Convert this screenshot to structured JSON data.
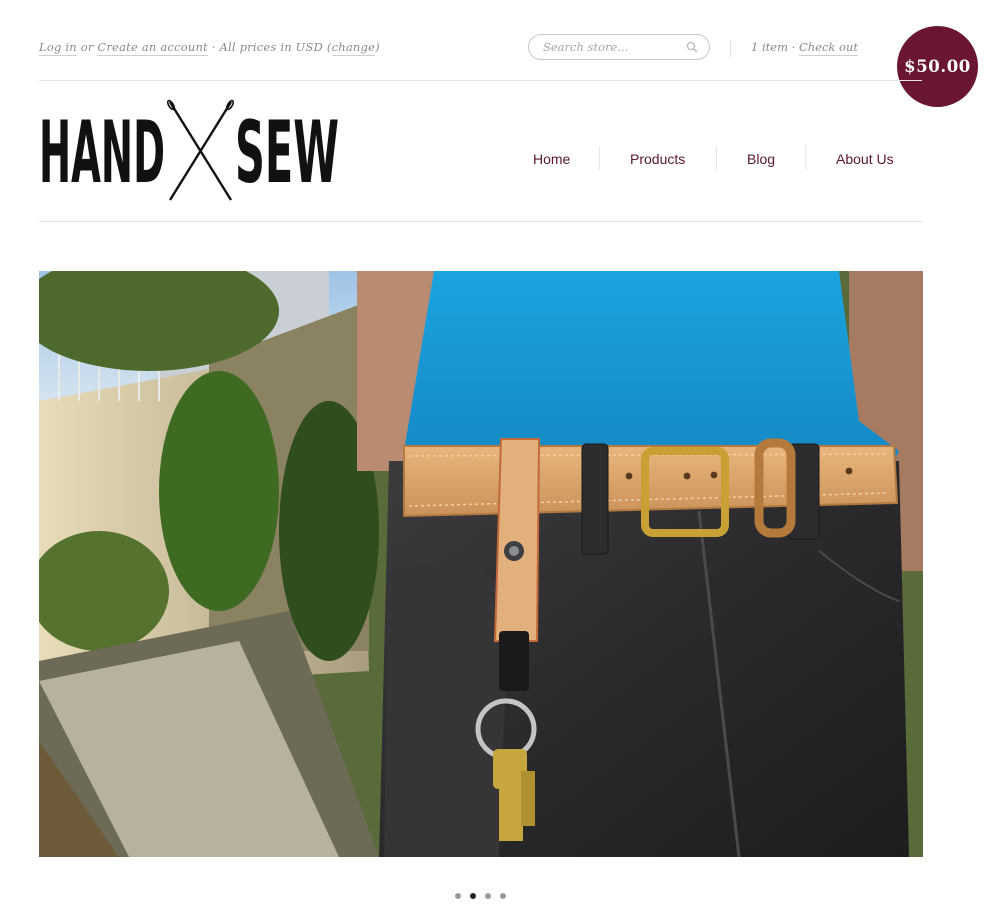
{
  "header": {
    "login_label": "Log in",
    "or_text": "or",
    "create_account_label": "Create an account",
    "prices_text": "· All prices in USD",
    "change_label": "change",
    "search": {
      "placeholder": "Search store..."
    },
    "cart": {
      "count_text": "1 item",
      "dot": "·",
      "checkout_label": "Check out",
      "total": "$50.00"
    }
  },
  "logo": {
    "left": "HAND",
    "right": "SEW"
  },
  "nav": {
    "items": [
      "Home",
      "Products",
      "Blog",
      "About Us"
    ]
  },
  "slideshow": {
    "slide_count": 4,
    "active_index": 1,
    "image_desc": "leather belt with key holder"
  },
  "colors": {
    "accent": "#6a1632",
    "nav_text": "#5b1630",
    "shirt": "#1a9ed9",
    "leather": "#d9a46a"
  }
}
